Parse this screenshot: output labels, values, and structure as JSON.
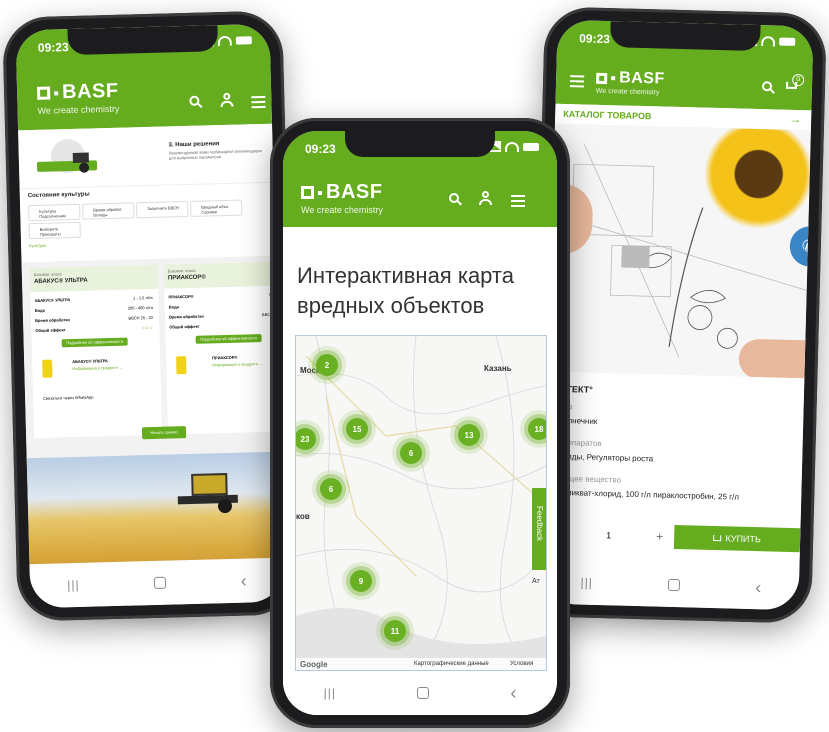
{
  "brand": {
    "name": "BASF",
    "tagline": "We create chemistry",
    "green": "#65ac1e"
  },
  "left_phone": {
    "time": "09:23",
    "hero_title": "3. Наши решения",
    "hero_text": "Рекомендуемая вами гербицидная рекомендация для выбранных параметров",
    "state_title": "Состояние культуры",
    "chips": [
      "Культура Подсолнечник",
      "Время обработ. Всходы",
      "Заполните ВВСН",
      "Вредный объе. Сорняки",
      "Выберите Препараты"
    ],
    "cultures_link": "Культуры",
    "cards": [
      {
        "label_small": "Базовое: класс",
        "title": "АБАКУС® УЛЬТРА",
        "rows": [
          {
            "k": "АБАКУС® УЛЬТРА",
            "v": "1 - 1,5 л/га"
          },
          {
            "k": "Вода",
            "v": "200 - 400 л/га"
          },
          {
            "k": "Время обработки",
            "v": "ВВСН 25 - 32"
          },
          {
            "k": "Общий эффект",
            "v": "☺☺☺"
          }
        ],
        "btn": "Подробнее об эффективности",
        "product": "АБАКУС® УЛЬТРА",
        "product_sub": "Информация о продукте →"
      },
      {
        "label_small": "Базовое: класс",
        "title": "ПРИАКСОР®",
        "rows": [
          {
            "k": "ПРИАКСОР®",
            "v": "0,"
          },
          {
            "k": "Вода",
            "v": ""
          },
          {
            "k": "Время обработки",
            "v": "ВВСН"
          },
          {
            "k": "Общий эффект",
            "v": ""
          }
        ],
        "btn": "Подробнее об эффективности",
        "product": "ПРИАКСОР®",
        "product_sub": "Информация о продукте →"
      }
    ],
    "whatsapp": "Связаться через WhatsApp",
    "more_btn": "Начать заново"
  },
  "center_phone": {
    "time": "09:23",
    "title": "Интерактивная карта вредных объектов",
    "cities": [
      "Москва",
      "Казань",
      "ков",
      "Ат"
    ],
    "clusters": [
      "2",
      "15",
      "23",
      "6",
      "13",
      "18",
      "6",
      "9",
      "11"
    ],
    "feedback": "Feedback",
    "map_footer": {
      "logo": "Google",
      "data": "Картографические данные",
      "terms": "Условия"
    }
  },
  "right_phone": {
    "time": "09:23",
    "cart_count": "0",
    "catalog": "КАТАЛОГ ТОВАРОВ",
    "product_title": "ИТЕКТ°",
    "field1_label": "ура",
    "field1_value": "солнечник",
    "field2_label": "препаратов",
    "field2_value": "ициды, Регуляторы роста",
    "field3_label": "ующее вещество",
    "field3_value": "мепикват-хлорид, 100 г/л пираклостробин, 25 г/л",
    "qty": "1",
    "qty_plus": "+",
    "buy": "КУПИТЬ"
  }
}
